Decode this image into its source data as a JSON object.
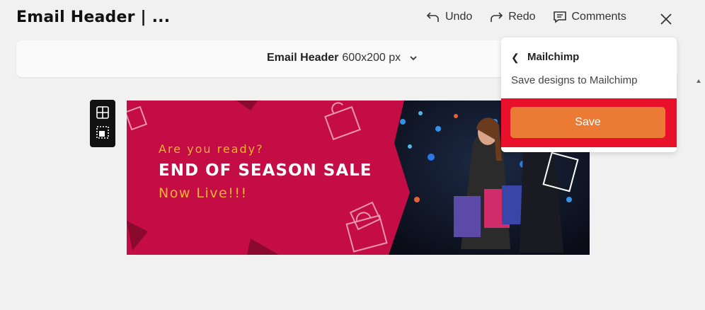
{
  "header": {
    "title": "Email Header | ...",
    "undo_label": "Undo",
    "redo_label": "Redo",
    "comments_label": "Comments"
  },
  "sizebar": {
    "name": "Email Header",
    "size": "600x200 px"
  },
  "canvas": {
    "line1": "Are you ready?",
    "line2": "END OF SEASON SALE",
    "line3": "Now Live!!!",
    "colors": {
      "background": "#c50d45",
      "accent": "#f2b233"
    }
  },
  "panel": {
    "back_icon": "chevron-left-icon",
    "title": "Mailchimp",
    "description": "Save designs to Mailchimp",
    "save_label": "Save",
    "save_color": "#eb7a35",
    "highlight_color": "#e8102a"
  }
}
